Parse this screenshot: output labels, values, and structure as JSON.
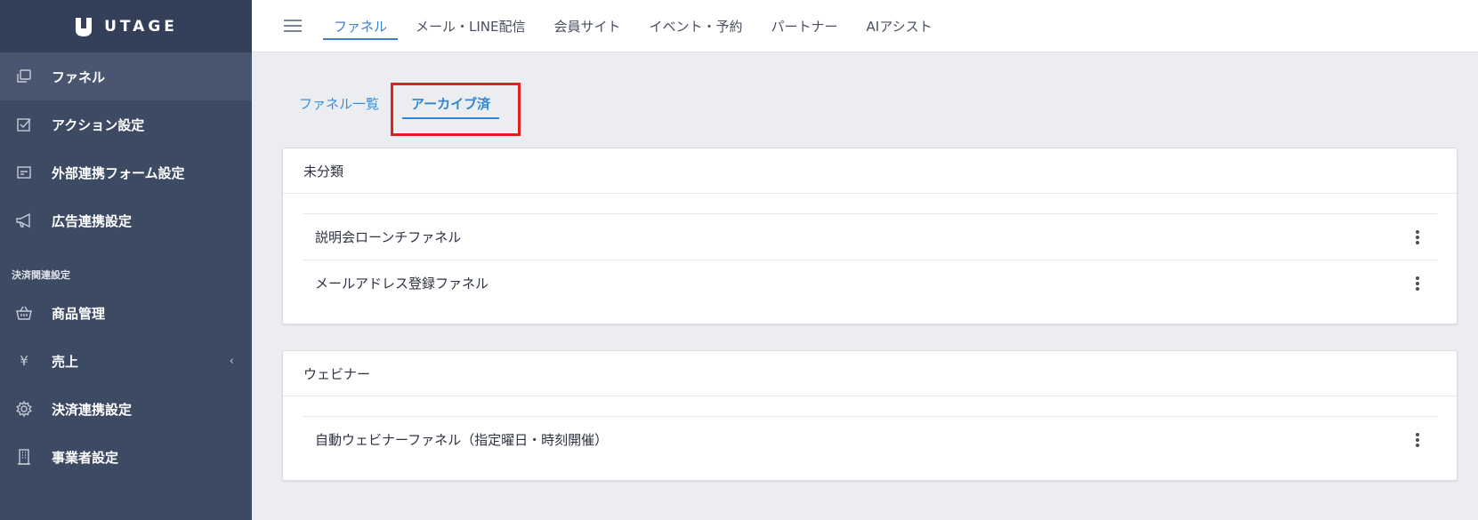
{
  "brand": {
    "name": "UTAGE"
  },
  "sidebar": {
    "items": [
      {
        "label": "ファネル",
        "icon": "funnel-copy-icon"
      },
      {
        "label": "アクション設定",
        "icon": "checkbox-icon"
      },
      {
        "label": "外部連携フォーム設定",
        "icon": "form-icon"
      },
      {
        "label": "広告連携設定",
        "icon": "megaphone-icon"
      }
    ],
    "section_label": "決済関連設定",
    "payment_items": [
      {
        "label": "商品管理",
        "icon": "basket-icon"
      },
      {
        "label": "売上",
        "icon": "yen-icon",
        "glyph": "¥"
      },
      {
        "label": "決済連携設定",
        "icon": "gear-icon"
      },
      {
        "label": "事業者設定",
        "icon": "building-icon"
      }
    ]
  },
  "topnav": {
    "tabs": [
      "ファネル",
      "メール・LINE配信",
      "会員サイト",
      "イベント・予約",
      "パートナー",
      "AIアシスト"
    ]
  },
  "subtabs": {
    "list": "ファネル一覧",
    "archived": "アーカイブ済"
  },
  "groups": [
    {
      "title": "未分類",
      "items": [
        "説明会ローンチファネル",
        "メールアドレス登録ファネル"
      ]
    },
    {
      "title": "ウェビナー",
      "items": [
        "自動ウェビナーファネル（指定曜日・時刻開催）"
      ]
    }
  ],
  "colors": {
    "sidebar": "#3d4a63",
    "accent": "#3a7fd5",
    "highlight": "#e0201c"
  }
}
